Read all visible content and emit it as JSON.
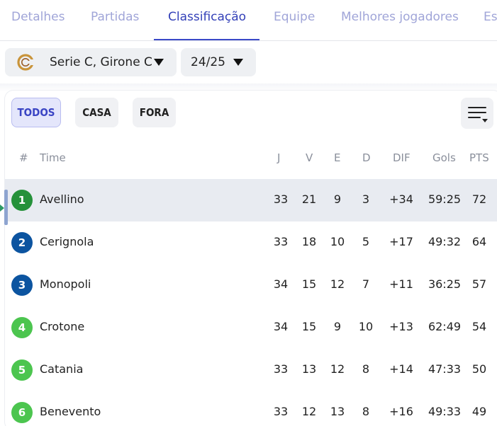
{
  "tabs": [
    {
      "label": "Detalhes",
      "active": false
    },
    {
      "label": "Partidas",
      "active": false
    },
    {
      "label": "Classificação",
      "active": true
    },
    {
      "label": "Equipe",
      "active": false
    },
    {
      "label": "Melhores jogadores",
      "active": false
    },
    {
      "label": "Es",
      "active": false
    }
  ],
  "filters": {
    "league": "Serie C, Girone C",
    "season": "24/25"
  },
  "chips": [
    {
      "label": "TODOS",
      "active": true
    },
    {
      "label": "CASA",
      "active": false
    },
    {
      "label": "FORA",
      "active": false
    }
  ],
  "table": {
    "headers": {
      "rank": "#",
      "team": "Time",
      "j": "J",
      "v": "V",
      "e": "E",
      "d": "D",
      "dif": "DIF",
      "gols": "Gols",
      "pts": "PTS"
    },
    "rows": [
      {
        "rank": "1",
        "team": "Avellino",
        "j": "33",
        "v": "21",
        "e": "9",
        "d": "3",
        "dif": "+34",
        "gols": "59:25",
        "pts": "72",
        "badge_color": "#25913a"
      },
      {
        "rank": "2",
        "team": "Cerignola",
        "j": "33",
        "v": "18",
        "e": "10",
        "d": "5",
        "dif": "+17",
        "gols": "49:32",
        "pts": "64",
        "badge_color": "#0c54a0"
      },
      {
        "rank": "3",
        "team": "Monopoli",
        "j": "34",
        "v": "15",
        "e": "12",
        "d": "7",
        "dif": "+11",
        "gols": "36:25",
        "pts": "57",
        "badge_color": "#0c54a0"
      },
      {
        "rank": "4",
        "team": "Crotone",
        "j": "34",
        "v": "15",
        "e": "9",
        "d": "10",
        "dif": "+13",
        "gols": "62:49",
        "pts": "54",
        "badge_color": "#4cc54f"
      },
      {
        "rank": "5",
        "team": "Catania",
        "j": "33",
        "v": "13",
        "e": "12",
        "d": "8",
        "dif": "+14",
        "gols": "47:33",
        "pts": "50",
        "badge_color": "#4cc54f"
      },
      {
        "rank": "6",
        "team": "Benevento",
        "j": "33",
        "v": "12",
        "e": "13",
        "d": "8",
        "dif": "+16",
        "gols": "49:33",
        "pts": "49",
        "badge_color": "#4cc54f"
      }
    ]
  },
  "colors": {
    "accent": "#3a48c8",
    "highlight_row": "#e8ebf1"
  }
}
